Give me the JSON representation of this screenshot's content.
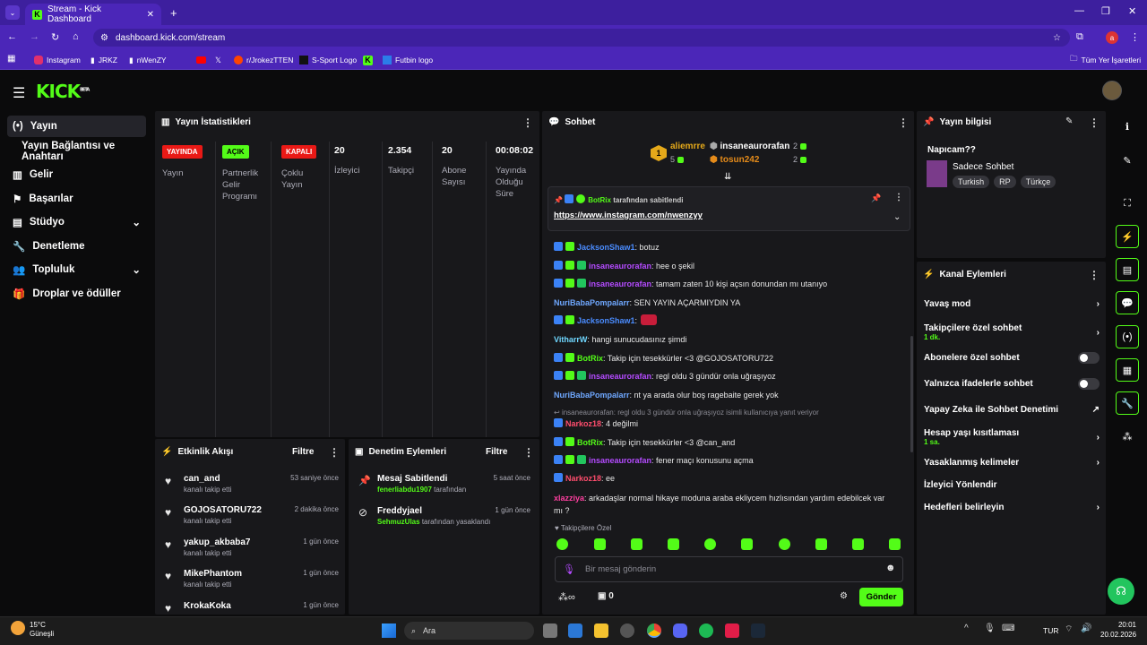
{
  "browser": {
    "tab_title": "Stream - Kick Dashboard",
    "url": "dashboard.kick.com/stream",
    "profile_initial": "a",
    "bookmarks": [
      "Instagram",
      "JRKZ",
      "nWenZY",
      "",
      "",
      "r/JrokezTTEN",
      "S-Sport Logo",
      "",
      "Futbin logo"
    ],
    "all_bookmarks": "Tüm Yer İşaretleri"
  },
  "logo": "KICK",
  "logo_beta": "BETA",
  "sidebar": [
    {
      "label": "Yayın",
      "icon": "broadcast-icon"
    },
    {
      "label": "Yayın Bağlantısı ve Anahtarı",
      "icon": ""
    },
    {
      "label": "Gelir",
      "icon": "chart-icon"
    },
    {
      "label": "Başarılar",
      "icon": "flag-icon"
    },
    {
      "label": "Stüdyo",
      "icon": "studio-icon"
    },
    {
      "label": "Denetleme",
      "icon": "wrench-icon"
    },
    {
      "label": "Topluluk",
      "icon": "people-icon"
    },
    {
      "label": "Droplar ve ödüller",
      "icon": "gift-icon"
    }
  ],
  "stats": {
    "title": "Yayın İstatistikleri",
    "items": [
      {
        "value": "YAYINDA",
        "label": "Yayın",
        "color": "#e91916"
      },
      {
        "value": "AÇIK",
        "label": "Partnerlik Gelir Programı",
        "color": "#53fc18"
      },
      {
        "value": "KAPALI",
        "label": "Çoklu Yayın",
        "color": "#e91916"
      },
      {
        "value": "20",
        "label": "İzleyici"
      },
      {
        "value": "2.354",
        "label": "Takipçi"
      },
      {
        "value": "20",
        "label": "Abone Sayısı"
      },
      {
        "value": "00:08:02",
        "label": "Yayında Olduğu Süre"
      }
    ]
  },
  "activity": {
    "title": "Etkinlik Akışı",
    "filter": "Filtre",
    "items": [
      {
        "name": "can_and",
        "sub": "kanalı takip etti",
        "time": "53 saniye önce"
      },
      {
        "name": "GOJOSATORU722",
        "sub": "kanalı takip etti",
        "time": "2 dakika önce"
      },
      {
        "name": "yakup_akbaba7",
        "sub": "kanalı takip etti",
        "time": "1 gün önce"
      },
      {
        "name": "MikePhantom",
        "sub": "kanalı takip etti",
        "time": "1 gün önce"
      },
      {
        "name": "KrokaKoka",
        "sub": "",
        "time": "1 gün önce"
      }
    ]
  },
  "moderation": {
    "title": "Denetim Eylemleri",
    "filter": "Filtre",
    "items": [
      {
        "name": "Mesaj Sabitlendi",
        "by": "fenerliabdu1907",
        "suffix": "tarafından",
        "time": "5 saat önce"
      },
      {
        "name": "Freddyjael",
        "by": "SehmuzUlas",
        "suffix": "tarafından yasaklandı",
        "time": "1 gün önce"
      }
    ]
  },
  "chat": {
    "title": "Sohbet",
    "leaders": [
      {
        "rank": "1",
        "name": "aliemrre",
        "count": "5"
      },
      {
        "name": "insaneaurorafan",
        "count": "2"
      },
      {
        "name": "tosun242",
        "count": "2"
      }
    ],
    "pinned": {
      "by": "BotRix",
      "by_suffix": "tarafından sabitlendi",
      "link": "https://www.instagram.com/nwenzyy"
    },
    "messages": [
      {
        "user": "JacksonShaw1",
        "color": "#4a8cff",
        "text": ": botuz",
        "badges": 2
      },
      {
        "user": "insaneaurorafan",
        "color": "#b44bff",
        "text": ": hee o şekil",
        "badges": 3
      },
      {
        "user": "insaneaurorafan",
        "color": "#b44bff",
        "text": ": tamam zaten 10 kişi açsın donundan mı utanıyo",
        "badges": 3
      },
      {
        "user": "NuriBabaPompalarr",
        "color": "#6fa8ff",
        "text": ": SEN YAYIN AÇARMIYDIN YA",
        "badges": 0
      },
      {
        "user": "JacksonShaw1",
        "color": "#4a8cff",
        "text": ":",
        "badges": 2,
        "emote": true
      },
      {
        "user": "VitharrW",
        "color": "#6fd7ff",
        "text": ": hangi sunucudasınız şimdi",
        "badges": 0
      },
      {
        "user": "BotRix",
        "color": "#53fc18",
        "text": ": Takip için tesekkürler <3 @GOJOSATORU722",
        "badges": 2
      },
      {
        "user": "insaneaurorafan",
        "color": "#b44bff",
        "text": ": regl oldu 3 gündür onla uğraşıyoz",
        "badges": 3
      },
      {
        "user": "NuriBabaPompalarr",
        "color": "#6fa8ff",
        "text": ": nt ya arada olur boş ragebaite gerek yok",
        "badges": 0
      },
      {
        "reply": "insaneaurorafan: regl oldu 3 gündür onla uğraşıyoz isimli kullanıcıya yanıt veriyor"
      },
      {
        "user": "Narkoz18",
        "color": "#ff4d6d",
        "text": ": 4 değilmi",
        "badges": 1
      },
      {
        "user": "BotRix",
        "color": "#53fc18",
        "text": ": Takip için tesekkürler <3 @can_and",
        "badges": 2
      },
      {
        "user": "insaneaurorafan",
        "color": "#b44bff",
        "text": ": fener maçı konusunu açma",
        "badges": 3
      },
      {
        "user": "Narkoz18",
        "color": "#ff4d6d",
        "text": ": ee",
        "badges": 1
      },
      {
        "user": "xlazziya",
        "color": "#ff3fa0",
        "text": ": arkadaşlar normal hikaye moduna araba ekliycem hızlısından yardım edebilcek var",
        "text2": "mı ?",
        "badges": 0
      }
    ],
    "followers_only": "Takipçilere Özel",
    "input_placeholder": "Bir mesaj gönderin",
    "count": "0",
    "send": "Gönder"
  },
  "stream_info": {
    "title": "Yayın bilgisi",
    "stream_title": "Napıcam??",
    "category": "Sadece Sohbet",
    "tags": [
      "Turkish",
      "RP",
      "Türkçe"
    ]
  },
  "channel_actions": {
    "title": "Kanal Eylemleri",
    "items": [
      {
        "label": "Yavaş mod",
        "type": "arrow"
      },
      {
        "label": "Takipçilere özel sohbet",
        "sub": "1 dk.",
        "type": "arrow"
      },
      {
        "label": "Abonelere özel sohbet",
        "type": "toggle"
      },
      {
        "label": "Yalnızca ifadelerle sohbet",
        "type": "toggle"
      },
      {
        "label": "Yapay Zeka ile Sohbet Denetimi",
        "type": "ext"
      },
      {
        "label": "Hesap yaşı kısıtlaması",
        "sub": "1 sa.",
        "type": "arrow"
      },
      {
        "label": "Yasaklanmış kelimeler",
        "type": "arrow"
      },
      {
        "label": "İzleyici Yönlendir",
        "type": "none"
      },
      {
        "label": "Hedefleri belirleyin",
        "type": "arrow"
      }
    ]
  },
  "taskbar": {
    "weather_temp": "15°C",
    "weather_desc": "Güneşli",
    "search": "Ara",
    "lang": "TUR",
    "time": "20:01",
    "date": "20.02.2026"
  },
  "colors": {
    "accent": "#53fc18",
    "panel": "#18181b",
    "browser": "#4b26b8"
  }
}
